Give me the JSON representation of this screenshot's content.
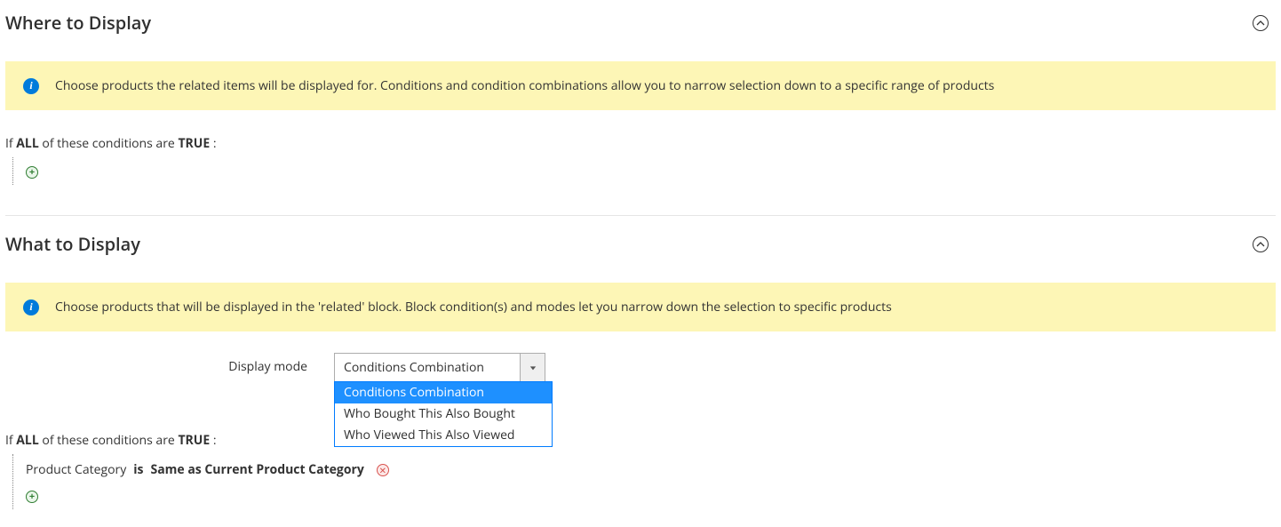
{
  "section1": {
    "title": "Where to Display",
    "info": "Choose products the related items will be displayed for. Conditions and condition combinations allow you to narrow selection down to a specific range of products",
    "condition_prefix": "If",
    "condition_aggregator": "ALL",
    "condition_middle": "of these conditions are",
    "condition_value": "TRUE",
    "condition_suffix": ":"
  },
  "section2": {
    "title": "What to Display",
    "info": "Choose products that will be displayed in the 'related' block. Block condition(s) and modes let you narrow down the selection to specific products",
    "display_mode_label": "Display mode",
    "display_mode_value": "Conditions Combination",
    "dropdown_options": {
      "0": "Conditions Combination",
      "1": "Who Bought This Also Bought",
      "2": "Who Viewed This Also Viewed"
    },
    "condition_prefix": "If",
    "condition_aggregator": "ALL",
    "condition_middle": "of these conditions are",
    "condition_value": "TRUE",
    "condition_suffix": ":",
    "rule_attribute": "Product Category",
    "rule_operator": "is",
    "rule_value": "Same as Current Product Category"
  }
}
